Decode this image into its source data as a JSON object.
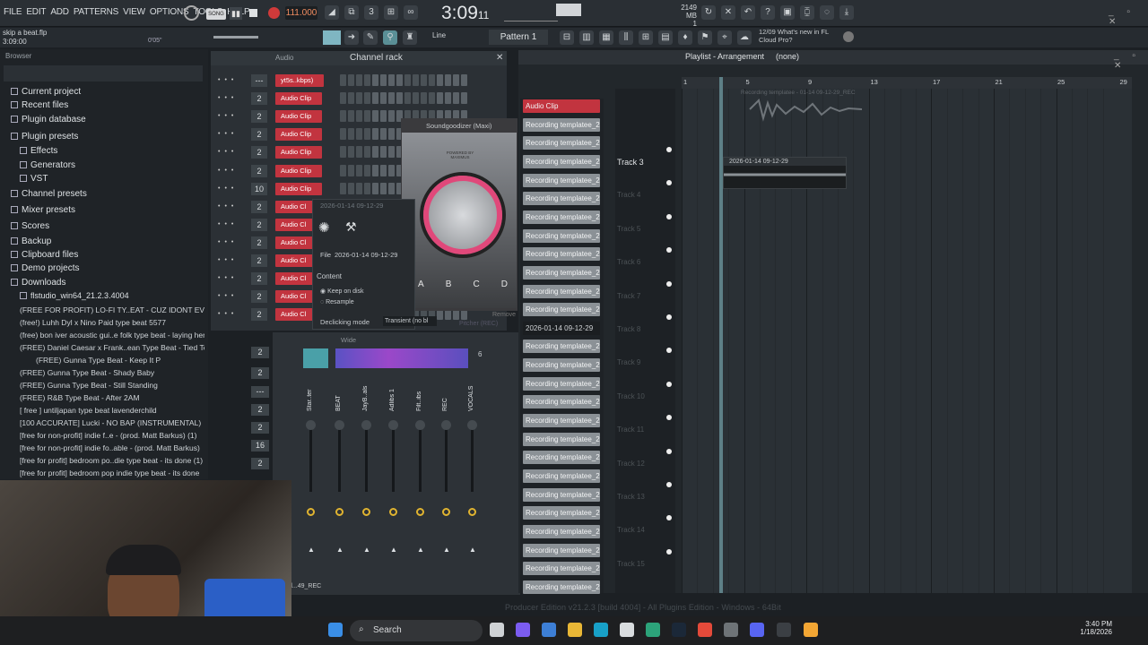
{
  "menu": [
    "FILE",
    "EDIT",
    "ADD",
    "PATTERNS",
    "VIEW",
    "OPTIONS",
    "TOOLS",
    "HELP"
  ],
  "transport": {
    "mode": "SONG",
    "bpm": "111.000",
    "time": "3:09",
    "time_sub": "11",
    "cpu": "2149 MB",
    "cpu_sub": "1",
    "pattern": "Pattern 1",
    "snap": "Line"
  },
  "hint": {
    "line1": "skip a beat.flp",
    "line2": "3:09:00",
    "line3": "0'05\""
  },
  "news": {
    "date": "12/09",
    "text": "What's new in FL",
    "text2": "Cloud Pro?"
  },
  "browser": {
    "title": "Browser",
    "items": [
      "Current project",
      "Recent files",
      "Plugin database",
      "Plugin presets",
      "Effects",
      "Generators",
      "VST",
      "Channel presets",
      "Mixer presets",
      "Scores",
      "Backup",
      "Clipboard files",
      "Demo projects",
      "Downloads",
      "flstudio_win64_21.2.3.4004"
    ],
    "files": [
      "(FREE FOR PROFIT) LO-FI TY..EAT - CUZ IDONT EVEN KNOW",
      "(free!) Luhh Dyl x Nino Paid type beat 5577",
      "(free) bon iver  acoustic gui..e folk type beat - laying here",
      "(FREE) Daniel Caesar x Frank..ean Type Beat - Tied To You",
      "(FREE) Gunna Type Beat - Keep It P",
      "(FREE) Gunna Type Beat - Shady Baby",
      "(FREE) Gunna Type Beat - Still Standing",
      "(FREE) R&B Type Beat - After 2AM",
      "[ free ] untiljapan type beat lavenderchild",
      "[100 ACCURATE] Lucki - NO BAP (INSTRUMENTAL)",
      "[free for non-profit] indie f..e - (prod. Matt Barkus) (1)",
      "[free for non-profit] indie fo..able - (prod. Matt Barkus)",
      "[free for profit] bedroom po..die type beat - its done (1)",
      "[free for profit] bedroom pop  indie type beat - its done"
    ]
  },
  "channel_rack": {
    "title": "Channel rack",
    "filter": "Audio",
    "channels": [
      {
        "num": "---",
        "name": "yt5s..kbps)"
      },
      {
        "num": "2",
        "name": "Audio Clip"
      },
      {
        "num": "2",
        "name": "Audio Clip"
      },
      {
        "num": "2",
        "name": "Audio Clip"
      },
      {
        "num": "2",
        "name": "Audio Clip"
      },
      {
        "num": "2",
        "name": "Audio Clip"
      },
      {
        "num": "10",
        "name": "Audio Clip"
      },
      {
        "num": "2",
        "name": "Audio Cl"
      },
      {
        "num": "2",
        "name": "Audio Cl"
      },
      {
        "num": "2",
        "name": "Audio Cl"
      },
      {
        "num": "2",
        "name": "Audio Cl"
      },
      {
        "num": "2",
        "name": "Audio Cl"
      },
      {
        "num": "2",
        "name": "Audio Cl"
      },
      {
        "num": "2",
        "name": "Audio Cl"
      }
    ]
  },
  "clip_settings": {
    "title": "2026-01-14 09-12-29",
    "file_label": "File",
    "file_value": "2026-01-14 09-12-29 ...",
    "content": "Content",
    "keep": "Keep on disk",
    "resample": "Resample",
    "declick": "Declicking mode",
    "transient": "Transient (no bl"
  },
  "plugin": {
    "title": "Soundgoodizer (Maxi)",
    "brand": "POWERED BY MAXIMUS",
    "buttons": [
      "A",
      "B",
      "C",
      "D"
    ],
    "remove": "Remove",
    "pitcher": "Pitcher (REC)"
  },
  "mixer": {
    "mode": "Wide",
    "header_num": "6",
    "tracks": [
      "Star..ter",
      "BEAT",
      "JayB..als",
      "Adlibs 1",
      "Filt..ibs",
      "REC",
      "VOCALS"
    ],
    "footer": "d...49_REC"
  },
  "stray_nums": [
    "2",
    "2",
    "---",
    "2",
    "2",
    "16",
    "2",
    "2",
    "16"
  ],
  "playlist": {
    "title": "Playlist - Arrangement",
    "pattern_sel": "(none)",
    "patterns": [
      "Audio Clip",
      "Recording templatee_2",
      "Recording templatee_2",
      "Recording templatee_2",
      "Recording templatee_2",
      "Recording templatee_2",
      "Recording templatee_2",
      "Recording templatee_2",
      "Recording templatee_2",
      "Recording templatee_2",
      "Recording templatee_2",
      "Recording templatee_2",
      "2026-01-14 09-12-29",
      "Recording templatee_2",
      "Recording templatee_2",
      "Recording templatee_2",
      "Recording templatee_2",
      "Recording templatee_2",
      "Recording templatee_2",
      "Recording templatee_2",
      "Recording templatee_2",
      "Recording templatee_2",
      "Recording templatee_2",
      "Recording templatee_2",
      "Recording templatee_2",
      "Recording templatee_2",
      "Recording templatee_2"
    ],
    "tracks": [
      "Track 3",
      "Track 4",
      "Track 5",
      "Track 6",
      "Track 7",
      "Track 8",
      "Track 9",
      "Track 10",
      "Track 11",
      "Track 12",
      "Track 13",
      "Track 14",
      "Track 15"
    ],
    "ruler": [
      "1",
      "5",
      "9",
      "13",
      "17",
      "21",
      "25",
      "29"
    ],
    "clip_label": "2026-01-14 09-12-29",
    "ghost_clip": "Recording templatee - 01-14 09-12-29_REC"
  },
  "status": "Producer Edition v21.2.3 [build 4004] - All Plugins Edition - Windows - 64Bit",
  "taskbar": {
    "search": "Search",
    "time": "3:40 PM",
    "date": "1/18/2026"
  },
  "colors": {
    "channel_red": "#c2343f",
    "pattern_grey": "#8b9196",
    "accent_pink": "#e0487a"
  }
}
